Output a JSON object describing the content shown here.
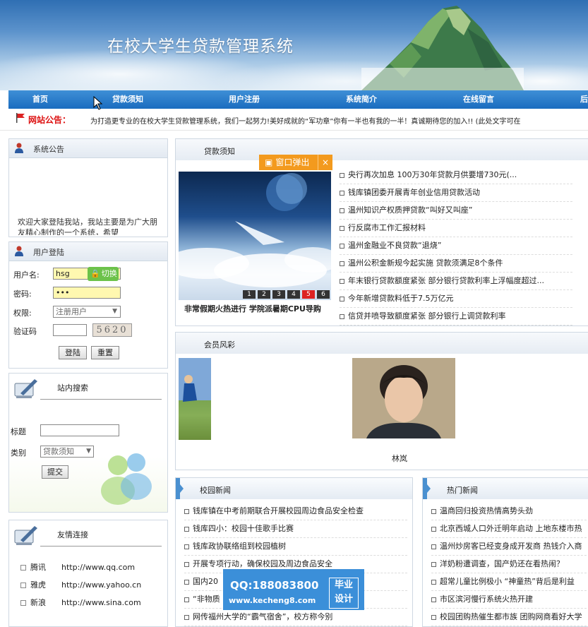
{
  "site": {
    "title": "在校大学生贷款管理系统"
  },
  "nav": {
    "items": [
      {
        "label": "首页"
      },
      {
        "label": "贷款须知"
      },
      {
        "label": "用户注册"
      },
      {
        "label": "系统简介"
      },
      {
        "label": "在线留言"
      },
      {
        "label": "后"
      }
    ]
  },
  "notice": {
    "label": "网站公告：",
    "text": "为打造更专业的在校大学生贷款管理系统，我们一起努力!美好成就的“军功章”你有一半也有我的一半！真诚期待您的加入!! (此处文字可在"
  },
  "sys_notice": {
    "title": "系统公告",
    "body": "欢迎大家登陆我站，我站主要是为广大朋友精心制作的一个系统，希望"
  },
  "login": {
    "title": "用户登陆",
    "username_label": "用户名:",
    "username_value": "hsg",
    "switch_label": "切换",
    "password_label": "密码:",
    "password_value": "•••",
    "role_label": "权限:",
    "role_value": "注册用户",
    "captcha_label": "验证码",
    "captcha_value": "5620",
    "login_btn": "登陆",
    "reset_btn": "重置"
  },
  "search": {
    "title": "站内搜索",
    "title_label": "标题",
    "category_label": "类别",
    "category_value": "贷款须知",
    "submit": "提交"
  },
  "links": {
    "title": "友情连接",
    "items": [
      {
        "name": "腾讯",
        "url": "http://www.qq.com"
      },
      {
        "name": "雅虎",
        "url": "http://www.yahoo.cn"
      },
      {
        "name": "新浪",
        "url": "http://www.sina.com"
      }
    ]
  },
  "loan_notice": {
    "title": "贷款须知",
    "popup_label": "窗口弹出",
    "popup_close": "×",
    "slide_caption": "非常假期火热进行 学院派暑期CPU导购",
    "slide_nums": [
      "1",
      "2",
      "3",
      "4",
      "5",
      "6"
    ],
    "slide_active": 4,
    "items": [
      "央行再次加息 100万30年贷款月供要增730元(...",
      "钱库镇团委开展青年创业信用贷款活动",
      "温州知识产权质押贷款“叫好又叫座”",
      "行反腐市工作汇报材料",
      "温州金融业不良贷款“退烧”",
      "温州公积金新规今起实施 贷款须满足8个条件",
      "年末银行贷款额度紧张 部分银行贷款利率上浮幅度超过...",
      "今年新增贷款料低于7.5万亿元",
      "信贷并喷导致额度紧张 部分银行上调贷款利率"
    ]
  },
  "members": {
    "title": "会员风彩",
    "member_name": "林岚"
  },
  "campus_news": {
    "title": "校园新闻",
    "items": [
      "钱库镇在中考前期联合开展校园周边食品安全检查",
      "钱库四小：校园十佳歌手比赛",
      "钱库政协联络组到校园植树",
      "开展专项行动，确保校园及周边食品安全",
      "国内20",
      "“非物质",
      "网传福州大学的“霸气宿舍”，校方称今别"
    ]
  },
  "hot_news": {
    "title": "热门新闻",
    "items": [
      "温商回归投资热情高势头劲",
      "北京西城人口外迁明年启动 上地东楼市热",
      "温州炒房客已经变身成开发商 热钱介入商",
      "洋奶粉遭调查，国产奶还在看热闹？",
      "超常儿童比例极小 “神童热”背后是利益",
      "市区滨河慢行系统火热开建",
      "校园团购热催生都市族 团购网商看好大学"
    ]
  },
  "watermark": {
    "qq": "QQ:188083800",
    "site": "www.kecheng8.com",
    "tag_line1": "毕业",
    "tag_line2": "设计"
  },
  "colors": {
    "nav_bg": "#1a6cbf",
    "notice_label": "#dd1111",
    "popup_bg": "#f39a1e",
    "switch_bg": "#6cc24a",
    "slide_active": "#dd2222"
  }
}
